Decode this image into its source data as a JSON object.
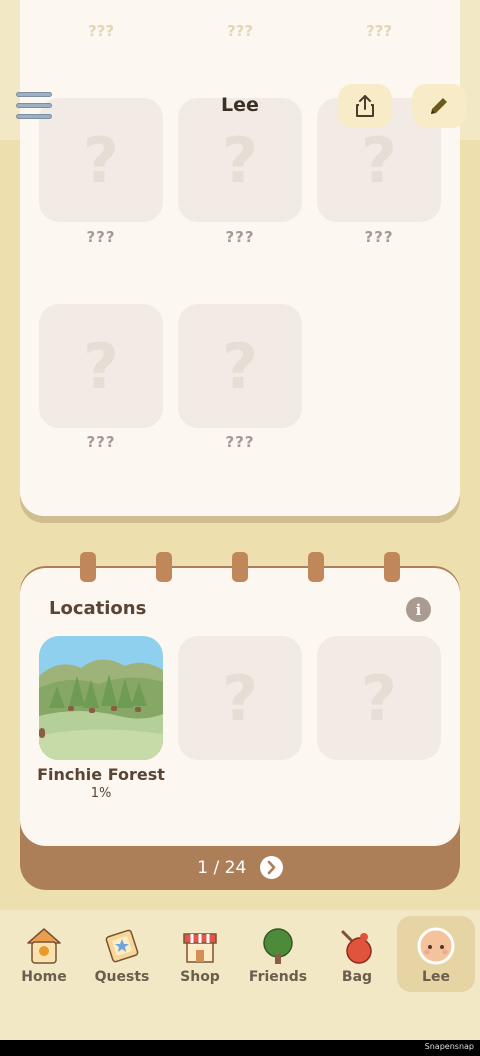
{
  "header": {
    "title": "Lee",
    "menu_icon": "hamburger-icon",
    "share_icon": "share-icon",
    "edit_icon": "pencil-icon"
  },
  "achievements": {
    "ghost_labels": [
      "???",
      "???",
      "???"
    ],
    "items": [
      {
        "label": "???",
        "icon": "question-mark-icon"
      },
      {
        "label": "???",
        "icon": "question-mark-icon"
      },
      {
        "label": "???",
        "icon": "question-mark-icon"
      },
      {
        "label": "???",
        "icon": "question-mark-icon"
      },
      {
        "label": "???",
        "icon": "question-mark-icon"
      }
    ]
  },
  "locations": {
    "title": "Locations",
    "info_icon": "info-icon",
    "items": [
      {
        "name": "Finchie Forest",
        "progress": "1%",
        "icon": "forest-image"
      },
      {
        "icon": "question-mark-icon"
      },
      {
        "icon": "question-mark-icon"
      }
    ],
    "pager": "1 / 24",
    "next_icon": "chevron-right-icon"
  },
  "nav": {
    "items": [
      {
        "label": "Home",
        "icon": "birdhouse-icon",
        "active": false
      },
      {
        "label": "Quests",
        "icon": "quest-map-icon",
        "active": false
      },
      {
        "label": "Shop",
        "icon": "shop-icon",
        "active": false
      },
      {
        "label": "Friends",
        "icon": "tree-icon",
        "active": false
      },
      {
        "label": "Bag",
        "icon": "bag-icon",
        "active": false
      },
      {
        "label": "Lee",
        "icon": "avatar-icon",
        "active": true
      }
    ]
  },
  "watermark": "Snapensnap",
  "colors": {
    "background": "#eedfae",
    "card": "#fdf7f1",
    "notebook_cover": "#ad7f59",
    "ring": "#c0885a",
    "nav_active": "#e6d4a4"
  }
}
